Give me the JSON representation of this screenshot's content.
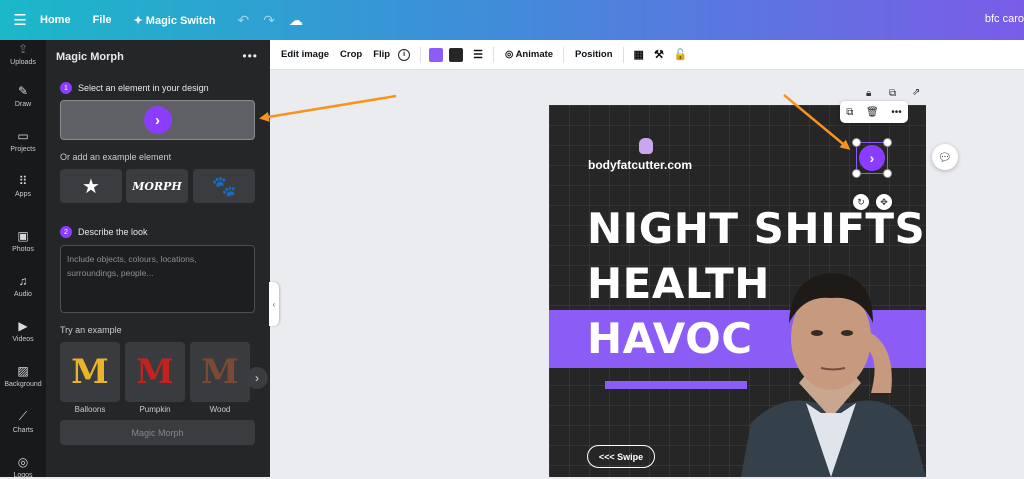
{
  "topbar": {
    "home": "Home",
    "file": "File",
    "magic_switch": "Magic Switch",
    "user": "bfc caro"
  },
  "rail": [
    {
      "label": "Uploads",
      "icon": "upload-icon"
    },
    {
      "label": "Draw",
      "icon": "pen-icon"
    },
    {
      "label": "Projects",
      "icon": "folder-icon"
    },
    {
      "label": "Apps",
      "icon": "grid-icon"
    },
    {
      "label": "Photos",
      "icon": "image-icon"
    },
    {
      "label": "Audio",
      "icon": "music-icon"
    },
    {
      "label": "Videos",
      "icon": "video-icon"
    },
    {
      "label": "Background",
      "icon": "pattern-icon"
    },
    {
      "label": "Charts",
      "icon": "chart-icon"
    },
    {
      "label": "Logos",
      "icon": "logo-icon"
    }
  ],
  "panel": {
    "title": "Magic Morph",
    "step1": "Select an element in your design",
    "step1_num": "1",
    "or_example": "Or add an example element",
    "morph_word": "MORPH",
    "step2": "Describe the look",
    "step2_num": "2",
    "placeholder": "Include objects, colours, locations, surroundings, people...",
    "try_example": "Try an example",
    "samples": [
      {
        "letter": "M",
        "caption": "Balloons"
      },
      {
        "letter": "M",
        "caption": "Pumpkin"
      },
      {
        "letter": "M",
        "caption": "Wood"
      }
    ],
    "button": "Magic Morph"
  },
  "toolbar": {
    "edit_image": "Edit image",
    "crop": "Crop",
    "flip": "Flip",
    "animate": "Animate",
    "position": "Position",
    "color1": "#8b5cf6",
    "color2": "#262626"
  },
  "design": {
    "brand": "bodyfatcutter.com",
    "line1": "NIGHT SHIFTS",
    "line2": "HEALTH",
    "line3": "HAVOC",
    "swipe": "<<< Swipe",
    "accent": "#8b5cf6"
  }
}
